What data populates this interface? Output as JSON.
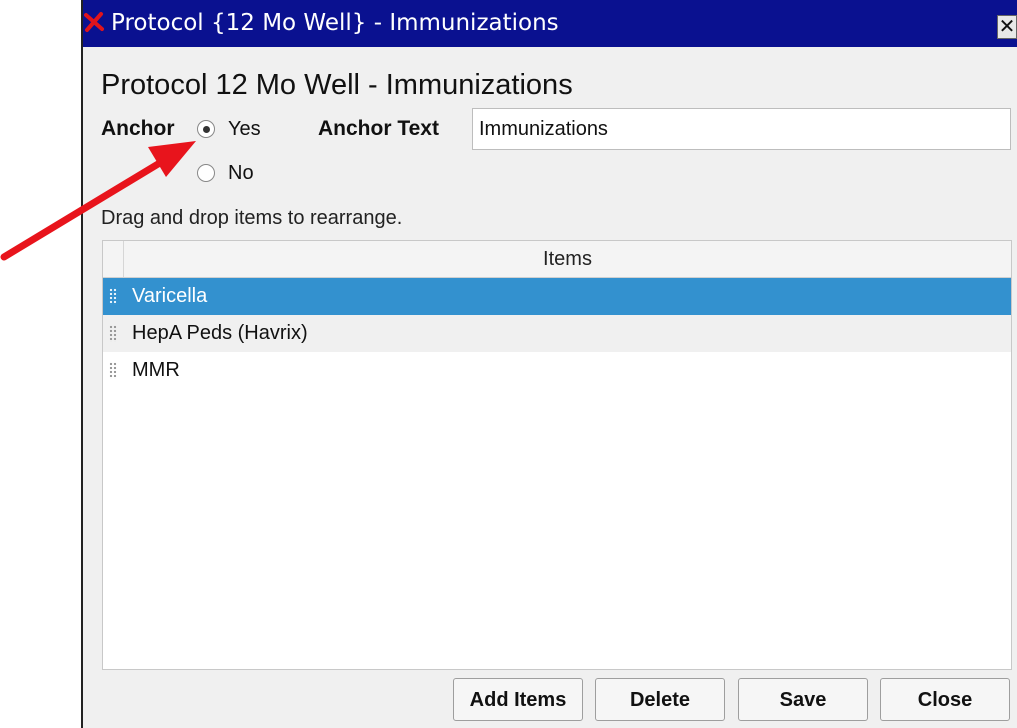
{
  "window": {
    "title": "Protocol {12 Mo Well} - Immunizations",
    "close_glyph": "✕"
  },
  "form": {
    "heading": "Protocol 12 Mo Well - Immunizations",
    "anchor_label": "Anchor",
    "anchor_options": [
      {
        "label": "Yes",
        "selected": true
      },
      {
        "label": "No",
        "selected": false
      }
    ],
    "anchor_text_label": "Anchor Text",
    "anchor_text_value": "Immunizations",
    "hint": "Drag and drop items to rearrange."
  },
  "list": {
    "column_header": "Items",
    "items": [
      {
        "label": "Varicella",
        "selected": true
      },
      {
        "label": "HepA Peds (Havrix)",
        "selected": false
      },
      {
        "label": "MMR",
        "selected": false
      }
    ]
  },
  "buttons": {
    "add_items": "Add Items",
    "delete": "Delete",
    "save": "Save",
    "close": "Close"
  },
  "colors": {
    "titlebar": "#0a1190",
    "selection": "#3391cf",
    "annotation_arrow": "#e8141c"
  },
  "icons": {
    "app": "red-x-icon",
    "drag": "drag-handle-icon"
  }
}
